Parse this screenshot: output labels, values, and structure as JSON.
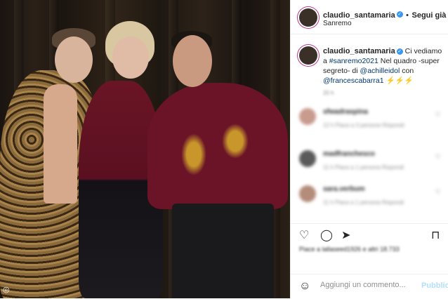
{
  "post": {
    "username": "claudio_santamaria",
    "verified_mark": "✓",
    "follow_label": "Segui già",
    "location": "Sanremo",
    "follow_separator": "•"
  },
  "caption": {
    "username": "claudio_santamaria",
    "text_1": " Ci vediamo a ",
    "hashtag": "#sanremo2021",
    "text_2": " Nel quadro -super segreto- di ",
    "mention_1": "@achilleidol",
    "text_3": " con ",
    "mention_2": "@francescabarra1",
    "emoji": " ⚡⚡⚡"
  },
  "timestamp": "20 h",
  "comments": [
    {
      "name": "sfwadraspina",
      "meta": "12 h   Piace a 3 persone   Rispondi",
      "avatar_color": "#c89b8e"
    },
    {
      "name": "madfranchesco",
      "meta": "11 h   Piace a 1 persona   Rispondi",
      "avatar_color": "#5a5a5a"
    },
    {
      "name": "sara.verbum",
      "meta": "11 h   Piace a 1 persona   Rispondi",
      "avatar_color": "#b38c7a"
    }
  ],
  "likes": "Piace a lallaseed1926 e altri 18.733",
  "add_comment": {
    "placeholder": "Aggiungi un commento...",
    "publish_label": "Pubblica"
  },
  "colors": {
    "accent": "#3897f0",
    "link": "#00376b",
    "publish_disabled": "#b2dffc"
  },
  "icons": [
    "heart-icon",
    "comment-icon",
    "share-icon",
    "bookmark-icon",
    "emoji-icon",
    "more-icon"
  ]
}
